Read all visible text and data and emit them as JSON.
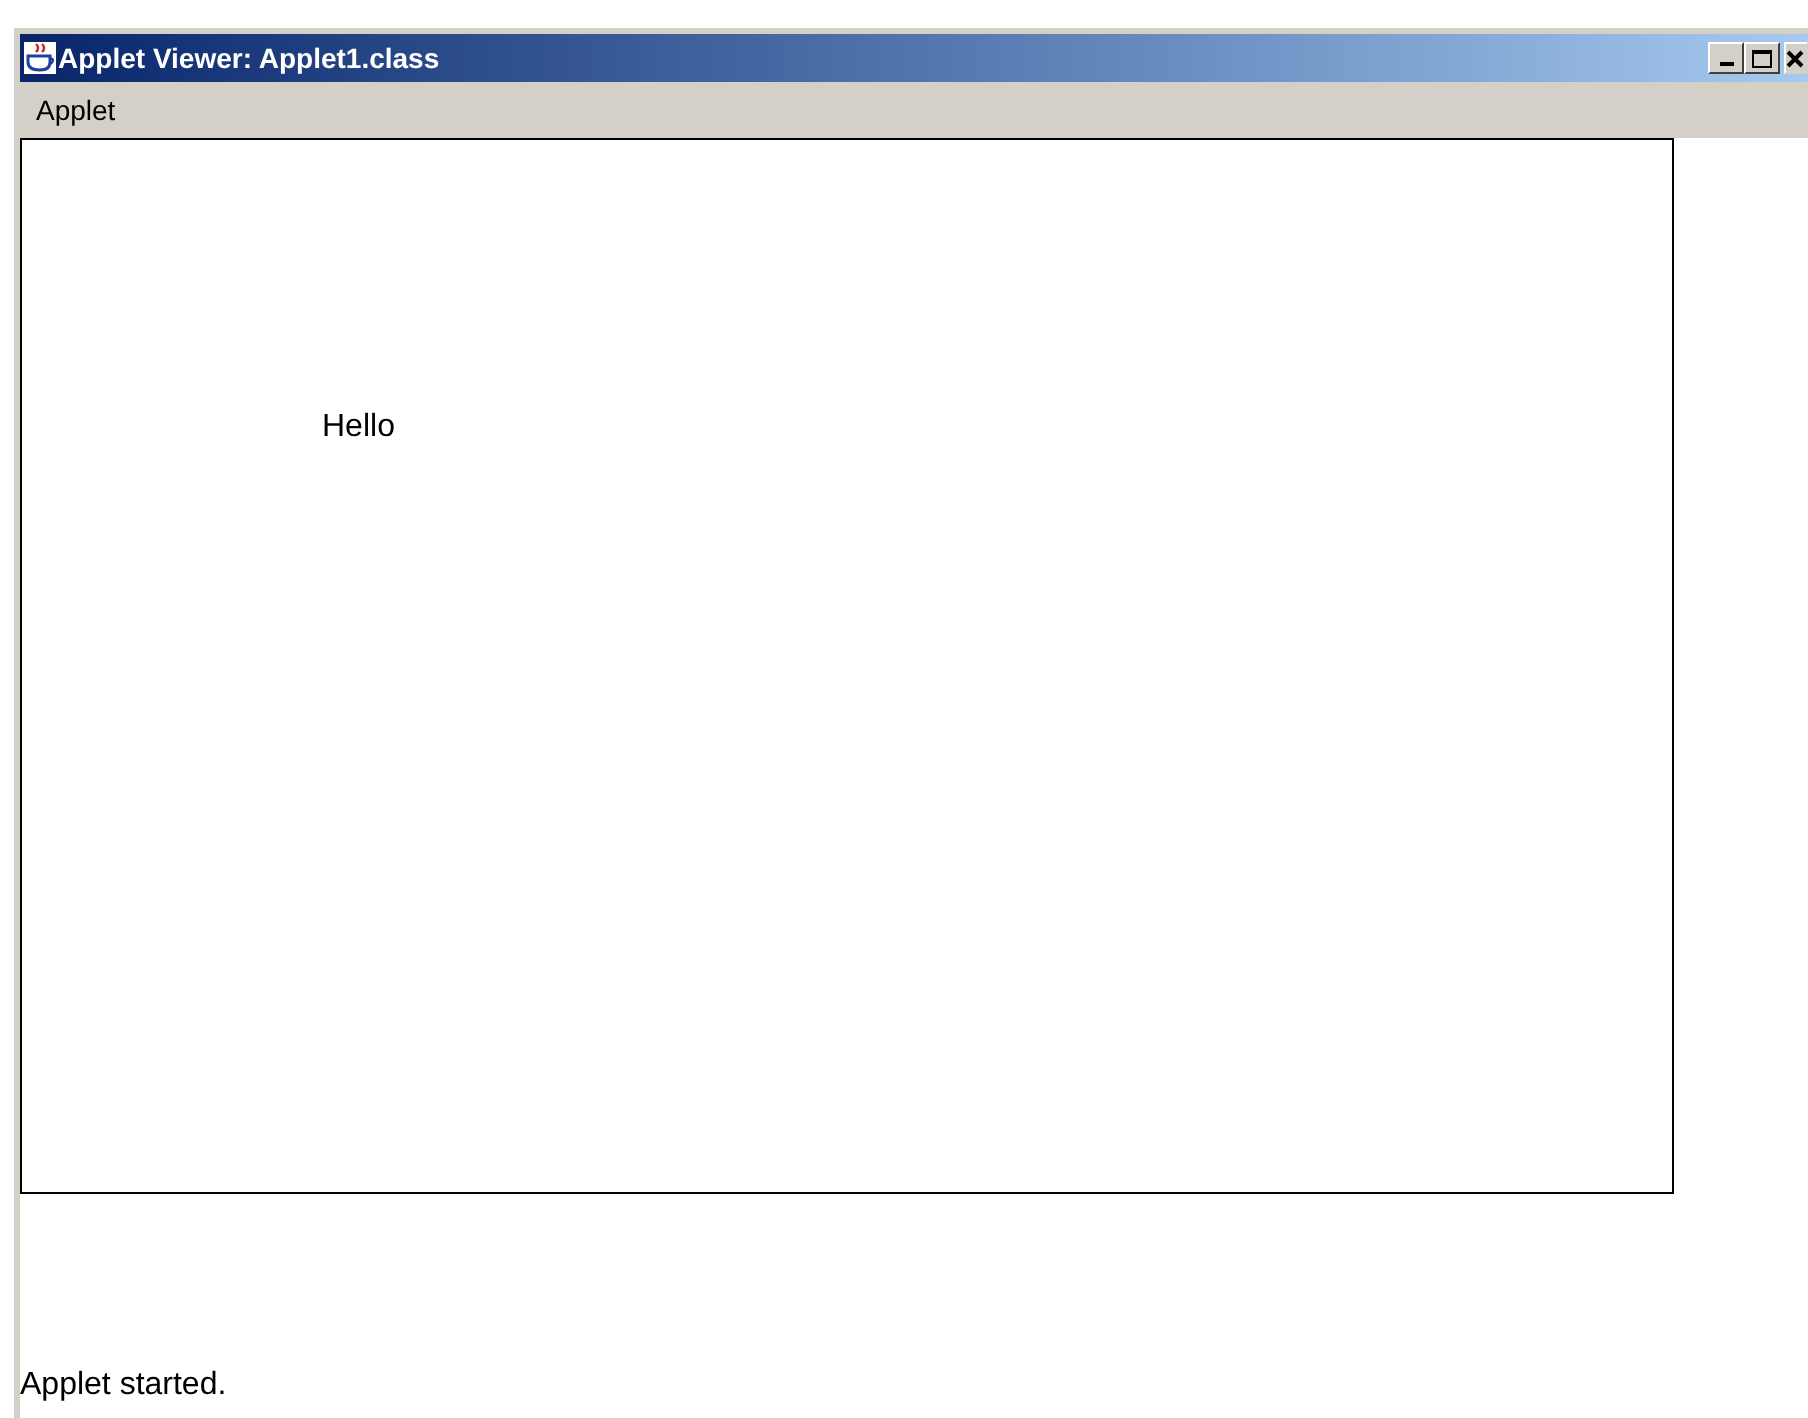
{
  "window": {
    "title": "Applet Viewer: Applet1.class"
  },
  "menu_bar": {
    "items": [
      {
        "label": "Applet"
      }
    ]
  },
  "applet": {
    "text": "Hello"
  },
  "status_bar": {
    "text": "Applet started."
  }
}
